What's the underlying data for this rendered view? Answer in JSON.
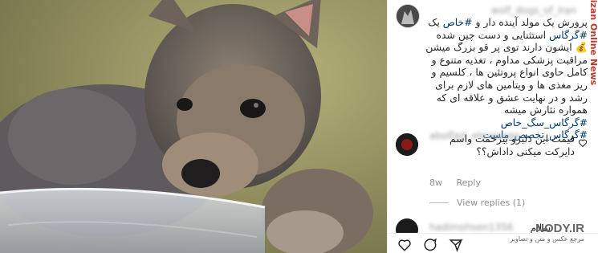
{
  "watermark_side": "Mizan Online News",
  "post": {
    "username": "wolf_dogs_of_iran",
    "caption": {
      "part1": "پرورش یک مولد آینده دار و",
      "tag1": "#خاص",
      "part2": "یک",
      "tag2": "#گرگاس",
      "part3": "استثنایی و دست چین شده 💰 ایشون دارند توی پر قو بزرگ میشن مراقبت پزشکی مداوم ، تغذیه متنوع و کامل حاوی انواع پروتئین ها ، کلسیم و ریز مغذی ها و ویتامین های لازم برای رشد و در نهایت عشق و علاقه ای که همواره نثارش میشه",
      "tag3": "#گرگاس_سگ_خاص",
      "tag4": "#گرگاس_تخصص_ماست"
    }
  },
  "comment": {
    "username": "abolfazl_eleraaaaa",
    "text": "قیمت این دلبرو بیزحمت واسم دایرکت میکنی داداش؟؟",
    "time": "8w",
    "reply_label": "Reply",
    "view_replies": "View replies (1)"
  },
  "comment2": {
    "username": "hadimohsen1356",
    "text": "سلام"
  },
  "site_watermark": {
    "name": "NODY.IR",
    "subtitle": "مرجع عکس و متن و تصاویر"
  }
}
